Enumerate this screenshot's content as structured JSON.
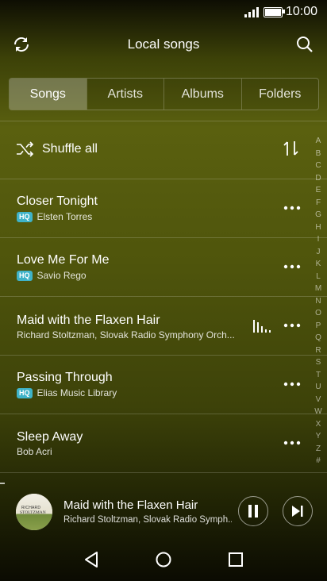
{
  "status": {
    "time": "10:00"
  },
  "header": {
    "title": "Local songs"
  },
  "tabs": [
    {
      "label": "Songs",
      "active": true
    },
    {
      "label": "Artists",
      "active": false
    },
    {
      "label": "Albums",
      "active": false
    },
    {
      "label": "Folders",
      "active": false
    }
  ],
  "shuffle": {
    "label": "Shuffle all"
  },
  "songs": [
    {
      "title": "Closer Tonight",
      "artist": "Elsten Torres",
      "hq": true,
      "badge": "HQ"
    },
    {
      "title": "Love Me For Me",
      "artist": "Savio Rego",
      "hq": true,
      "badge": "HQ"
    },
    {
      "title": "Maid with the Flaxen Hair",
      "artist": "Richard Stoltzman, Slovak Radio Symphony Orch...",
      "hq": false,
      "playing": true
    },
    {
      "title": "Passing Through",
      "artist": "Elias Music Library",
      "hq": true,
      "badge": "HQ"
    },
    {
      "title": "Sleep Away",
      "artist": "Bob Acri",
      "hq": false
    }
  ],
  "alphabet": [
    "A",
    "B",
    "C",
    "D",
    "E",
    "F",
    "G",
    "H",
    "I",
    "J",
    "K",
    "L",
    "M",
    "N",
    "O",
    "P",
    "Q",
    "R",
    "S",
    "T",
    "U",
    "V",
    "W",
    "X",
    "Y",
    "Z",
    "#"
  ],
  "player": {
    "title": "Maid with the Flaxen Hair",
    "artist": "Richard Stoltzman, Slovak Radio Symph...",
    "art_text_1": "RICHARD",
    "art_text_2": "STOLTZMAN"
  },
  "colors": {
    "hq_badge": "#3fb3c8"
  }
}
